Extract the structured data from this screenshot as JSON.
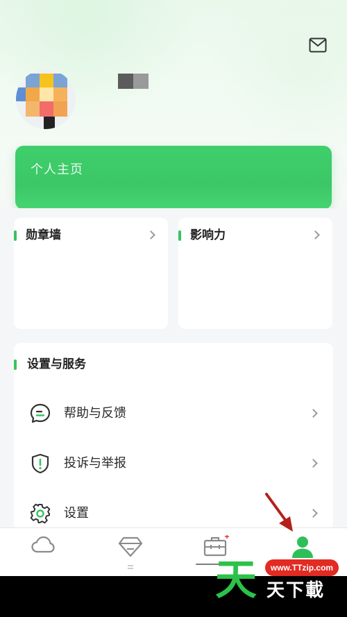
{
  "header": {
    "mail_icon": "mail-icon",
    "username": "■■"
  },
  "profile_card": {
    "label": "个人主页"
  },
  "cards": {
    "badges": {
      "title": "勋章墙"
    },
    "influence": {
      "title": "影响力"
    }
  },
  "services": {
    "title": "设置与服务",
    "items": [
      {
        "label": "帮助与反馈",
        "icon": "chat-bubble-icon"
      },
      {
        "label": "投诉与举报",
        "icon": "shield-alert-icon"
      },
      {
        "label": "设置",
        "icon": "gear-icon"
      }
    ]
  },
  "bottom_nav": {
    "items": [
      {
        "icon": "cloud-icon",
        "active": false
      },
      {
        "icon": "diamond-icon",
        "active": false
      },
      {
        "icon": "briefcase-icon",
        "active": false
      },
      {
        "icon": "person-icon",
        "active": true
      }
    ]
  },
  "watermark": {
    "url": "www.TTzip.com",
    "big": "天",
    "small": "天下載"
  },
  "colors": {
    "accent": "#3cc767",
    "background": "#f5f6f7",
    "watermark_red": "#e22b22",
    "watermark_green": "#2cc24a"
  }
}
